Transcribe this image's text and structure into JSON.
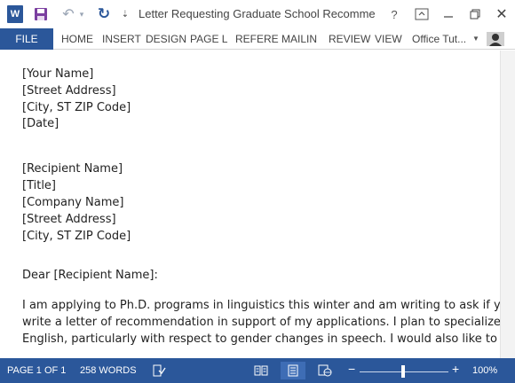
{
  "window": {
    "title": "Letter Requesting Graduate School Recommend...",
    "app_icon_letter": "W"
  },
  "ribbon": {
    "file_label": "FILE",
    "tabs": [
      "HOME",
      "INSERT",
      "DESIGN",
      "PAGE L",
      "REFERE",
      "MAILIN",
      "REVIEW",
      "VIEW"
    ],
    "account_label": "Office Tut..."
  },
  "document": {
    "lines": [
      "[Your Name]",
      "[Street Address]",
      "[City, ST ZIP Code]",
      "[Date]",
      "[Recipient Name]",
      "[Title]",
      "[Company Name]",
      "[Street Address]",
      "[City, ST ZIP Code]",
      "Dear [Recipient Name]:",
      "I am applying to Ph.D. programs in linguistics this winter and am writing to ask if you would be",
      "write a letter of recommendation in support of my applications. I plan to specialize in Sociolin",
      "English, particularly with respect to gender changes in speech. I would also like to further my"
    ]
  },
  "statusbar": {
    "page": "PAGE 1 OF 1",
    "words": "258 WORDS",
    "zoom": "100%"
  },
  "colors": {
    "accent": "#2b579a",
    "save_icon": "#7b3fa0"
  }
}
